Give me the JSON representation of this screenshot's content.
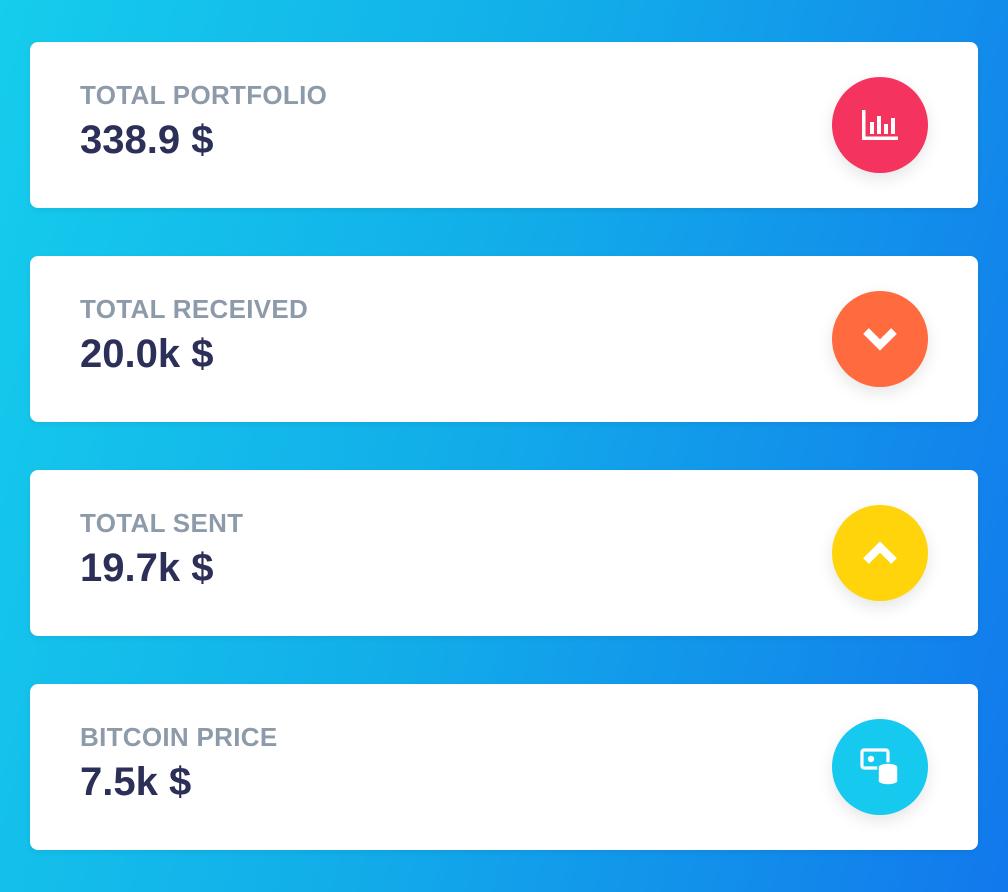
{
  "cards": [
    {
      "label": "TOTAL PORTFOLIO",
      "value": "338.9 $",
      "icon": "bar-chart-icon",
      "color": "#f5335f"
    },
    {
      "label": "TOTAL RECEIVED",
      "value": "20.0k $",
      "icon": "chevron-down-icon",
      "color": "#ff6a3f"
    },
    {
      "label": "TOTAL SENT",
      "value": "19.7k $",
      "icon": "chevron-up-icon",
      "color": "#ffd40a"
    },
    {
      "label": "BITCOIN PRICE",
      "value": "7.5k $",
      "icon": "money-coins-icon",
      "color": "#16c9ee"
    }
  ]
}
